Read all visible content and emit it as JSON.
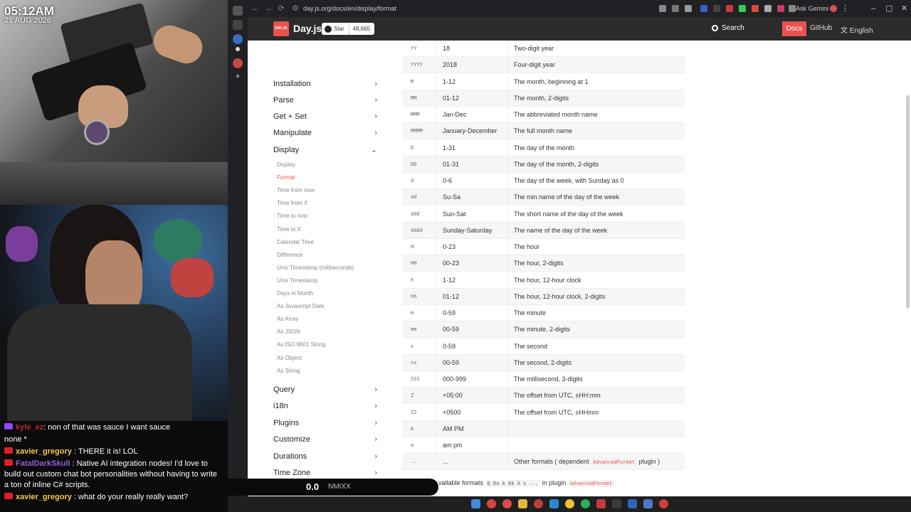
{
  "stream": {
    "clock_time": "05:12AM",
    "clock_date": "21 AUG 2026",
    "chat": [
      {
        "platform": "twitch",
        "user": "kyle_ez",
        "user_color": "#b02a2a",
        "message": ": non of that was sauce I want sauce"
      },
      {
        "platform": "",
        "user": "",
        "user_color": "#ffffff",
        "message": "none *"
      },
      {
        "platform": "youtube",
        "user": "xavier_gregory",
        "user_color": "#f2c94c",
        "message": " : THERE it is! LOL"
      },
      {
        "platform": "youtube",
        "user": "FatalDarkSkull",
        "user_color": "#8a63d2",
        "message": " : Native AI integration nodes! I'd love to build out custom chat bot personalities without having to write a ton of inline C# scripts."
      },
      {
        "platform": "youtube",
        "user": "xavier_gregory",
        "user_color": "#f2c94c",
        "message": " : what do your really really want?"
      }
    ]
  },
  "browser": {
    "url": "day.js.org/docs/en/display/format",
    "ask_gemini": "Ask Gemini"
  },
  "site": {
    "logo_mark": "DAY.JS",
    "logo_text": "Day.js",
    "star_label": "Star",
    "star_count": "48,665",
    "search_label": "Search",
    "docs_label": "Docs",
    "github_label": "GitHub",
    "language_label": "English",
    "accent_color": "#e8524f"
  },
  "sidebar": {
    "top_sections": [
      "Installation",
      "Parse",
      "Get + Set",
      "Manipulate",
      "Display"
    ],
    "display_subitems": [
      "Display",
      "Format",
      "Time from now",
      "Time from X",
      "Time to now",
      "Time to X",
      "Calendar Time",
      "Difference",
      "Unix Timestamp (milliseconds)",
      "Unix Timestamp",
      "Days in Month",
      "As Javascript Date",
      "As Array",
      "As JSON",
      "As ISO 8601 String",
      "As Object",
      "As String"
    ],
    "active_subitem": "Format",
    "bottom_sections": [
      "Query",
      "i18n",
      "Plugins",
      "Customize",
      "Durations",
      "Time Zone"
    ]
  },
  "format_table": [
    {
      "token": "YY",
      "output": "18",
      "description": "Two-digit year"
    },
    {
      "token": "YYYY",
      "output": "2018",
      "description": "Four-digit year"
    },
    {
      "token": "M",
      "output": "1-12",
      "description": "The month, beginning at 1"
    },
    {
      "token": "MM",
      "output": "01-12",
      "description": "The month, 2-digits"
    },
    {
      "token": "MMM",
      "output": "Jan-Dec",
      "description": "The abbreviated month name"
    },
    {
      "token": "MMMM",
      "output": "January-December",
      "description": "The full month name"
    },
    {
      "token": "D",
      "output": "1-31",
      "description": "The day of the month"
    },
    {
      "token": "DD",
      "output": "01-31",
      "description": "The day of the month, 2-digits"
    },
    {
      "token": "d",
      "output": "0-6",
      "description": "The day of the week, with Sunday as 0"
    },
    {
      "token": "dd",
      "output": "Su-Sa",
      "description": "The min name of the day of the week"
    },
    {
      "token": "ddd",
      "output": "Sun-Sat",
      "description": "The short name of the day of the week"
    },
    {
      "token": "dddd",
      "output": "Sunday-Saturday",
      "description": "The name of the day of the week"
    },
    {
      "token": "H",
      "output": "0-23",
      "description": "The hour"
    },
    {
      "token": "HH",
      "output": "00-23",
      "description": "The hour, 2-digits"
    },
    {
      "token": "h",
      "output": "1-12",
      "description": "The hour, 12-hour clock"
    },
    {
      "token": "hh",
      "output": "01-12",
      "description": "The hour, 12-hour clock, 2-digits"
    },
    {
      "token": "m",
      "output": "0-59",
      "description": "The minute"
    },
    {
      "token": "mm",
      "output": "00-59",
      "description": "The minute, 2-digits"
    },
    {
      "token": "s",
      "output": "0-59",
      "description": "The second"
    },
    {
      "token": "ss",
      "output": "00-59",
      "description": "The second, 2-digits"
    },
    {
      "token": "SSS",
      "output": "000-999",
      "description": "The millisecond, 3-digits"
    },
    {
      "token": "Z",
      "output": "+05:00",
      "description": "The offset from UTC, ±HH:mm"
    },
    {
      "token": "ZZ",
      "output": "+0500",
      "description": "The offset from UTC, ±HHmm"
    },
    {
      "token": "A",
      "output": "AM PM",
      "description": ""
    },
    {
      "token": "a",
      "output": "am pm",
      "description": ""
    }
  ],
  "last_row": {
    "token": "...",
    "output": "...",
    "desc_before": "Other formats ( dependent ",
    "desc_code": "AdvancedFormat",
    "desc_after": " plugin )"
  },
  "more_formats": {
    "prefix": "vailable formats",
    "codes": "Q Do k kk X x ...",
    "middle": "in plugin",
    "plugin": "AdvancedFormat"
  },
  "music_overlay": {
    "level": "0.0",
    "title": "NMIXX"
  }
}
